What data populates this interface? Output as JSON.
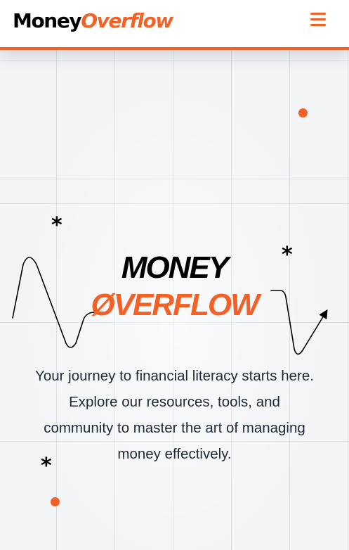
{
  "header": {
    "logo_part1": "Money",
    "logo_part2": "Overflow",
    "menu_icon": "hamburger-menu-icon"
  },
  "hero": {
    "title_line1": "MONEY",
    "title_line2": "ØVERFLOW",
    "description": "Your journey to financial literacy starts here. Explore our resources, tools, and community to master the art of managing money effectively."
  },
  "decor": {
    "star_glyph": "*",
    "star_icon": "asterisk-icon",
    "dot_icon": "orange-dot-icon",
    "graph_icon": "trend-line-icon"
  },
  "colors": {
    "accent": "#f26125",
    "text": "#000000",
    "body_text": "#1f2937",
    "background": "#f3f4f6"
  }
}
